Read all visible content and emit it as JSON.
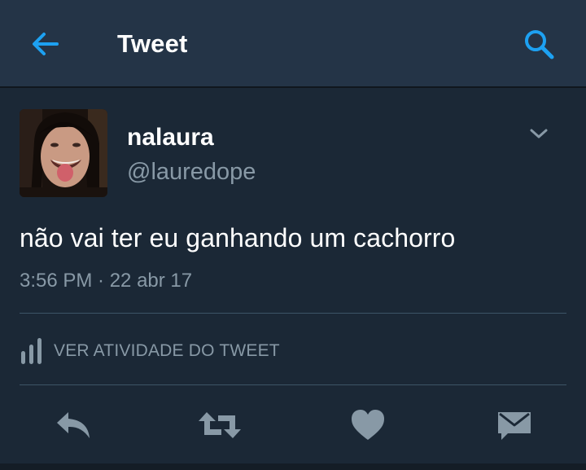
{
  "header": {
    "title": "Tweet",
    "back_icon": "arrow-left-icon",
    "search_icon": "search-icon",
    "accent_color": "#1da1f2",
    "background": "#243447"
  },
  "tweet": {
    "display_name": "nalaura",
    "handle": "@lauredope",
    "text": "não vai ter eu ganhando um cachorro",
    "timestamp": "3:56 PM · 22 abr 17",
    "menu_icon": "chevron-down-icon"
  },
  "activity": {
    "label": "VER ATIVIDADE DO TWEET",
    "icon": "bar-chart-icon"
  },
  "actions": [
    {
      "name": "reply",
      "icon": "reply-icon"
    },
    {
      "name": "retweet",
      "icon": "retweet-icon"
    },
    {
      "name": "like",
      "icon": "heart-icon"
    },
    {
      "name": "direct-message",
      "icon": "envelope-icon"
    }
  ],
  "colors": {
    "page_background": "#1b2836",
    "secondary_text": "#8899a6",
    "divider": "#3d5466",
    "action_icon": "#8899a6"
  }
}
